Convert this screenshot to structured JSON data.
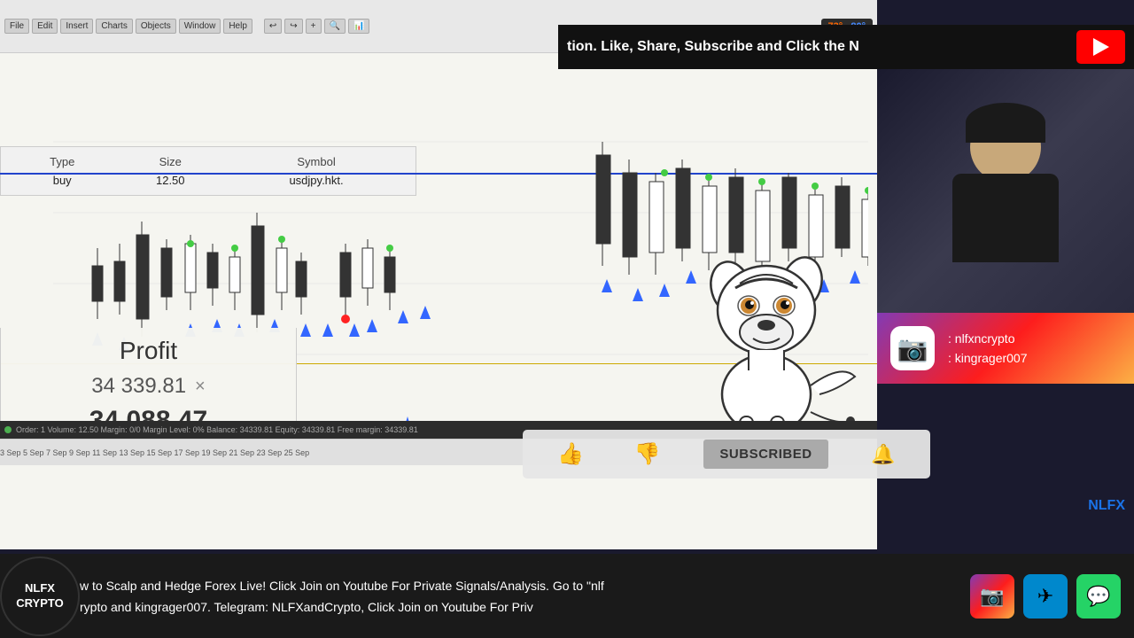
{
  "toolbar": {
    "temp": {
      "hot": "73°",
      "cold": "80°"
    },
    "buttons": [
      "File",
      "Edit",
      "Insert",
      "Charts",
      "Objects",
      "Window",
      "Help"
    ]
  },
  "order": {
    "type_label": "Type",
    "size_label": "Size",
    "symbol_label": "Symbol",
    "type_value": "buy",
    "size_value": "12.50",
    "symbol_value": "usdjpy.hkt."
  },
  "profit": {
    "label": "Profit",
    "value1": "34 339.81",
    "value2": "34 088.47",
    "close_symbol": "×"
  },
  "subscribe": {
    "subscribed_label": "SUBSCRIBED",
    "bell": "🔔"
  },
  "yt_banner": {
    "text": "tion.  Like, Share, Subscribe and Click the N"
  },
  "streamer": {
    "platform": "webcam"
  },
  "instagram": {
    "label1": ": nlfxncrypto",
    "label2": ": kingrager007"
  },
  "bottom_bar": {
    "logo_line1": "NLFX",
    "logo_line2": "CRYPTO",
    "scroll_line1": "w to Scalp and Hedge Forex Live! Click Join on Youtube For Private Signals/Analysis. Go to \"nlf",
    "scroll_line2": "rypto and kingrager007.  Telegram: NLFXandCrypto,  Click Join on Youtube For Priv"
  },
  "chart_bottom": {
    "text": "  3 Sep   5 Sep   7 Sep   9 Sep   11 Sep   13 Sep   15 Sep   17 Sep   19 Sep   21 Sep   23 Sep   25 Sep"
  },
  "status_bar": {
    "text": "Order: 1   Volume: 12.50   Margin: 0/0   Margin Level: 0%   Balance: 34339.81   Equity: 34339.81   Free margin: 34339.81"
  },
  "nlfx_watermark": "NLFX",
  "icons": {
    "like": "👍",
    "dislike": "👎",
    "instagram": "📷",
    "telegram": "✈",
    "whatsapp": "💬",
    "yt_play": "▶"
  }
}
